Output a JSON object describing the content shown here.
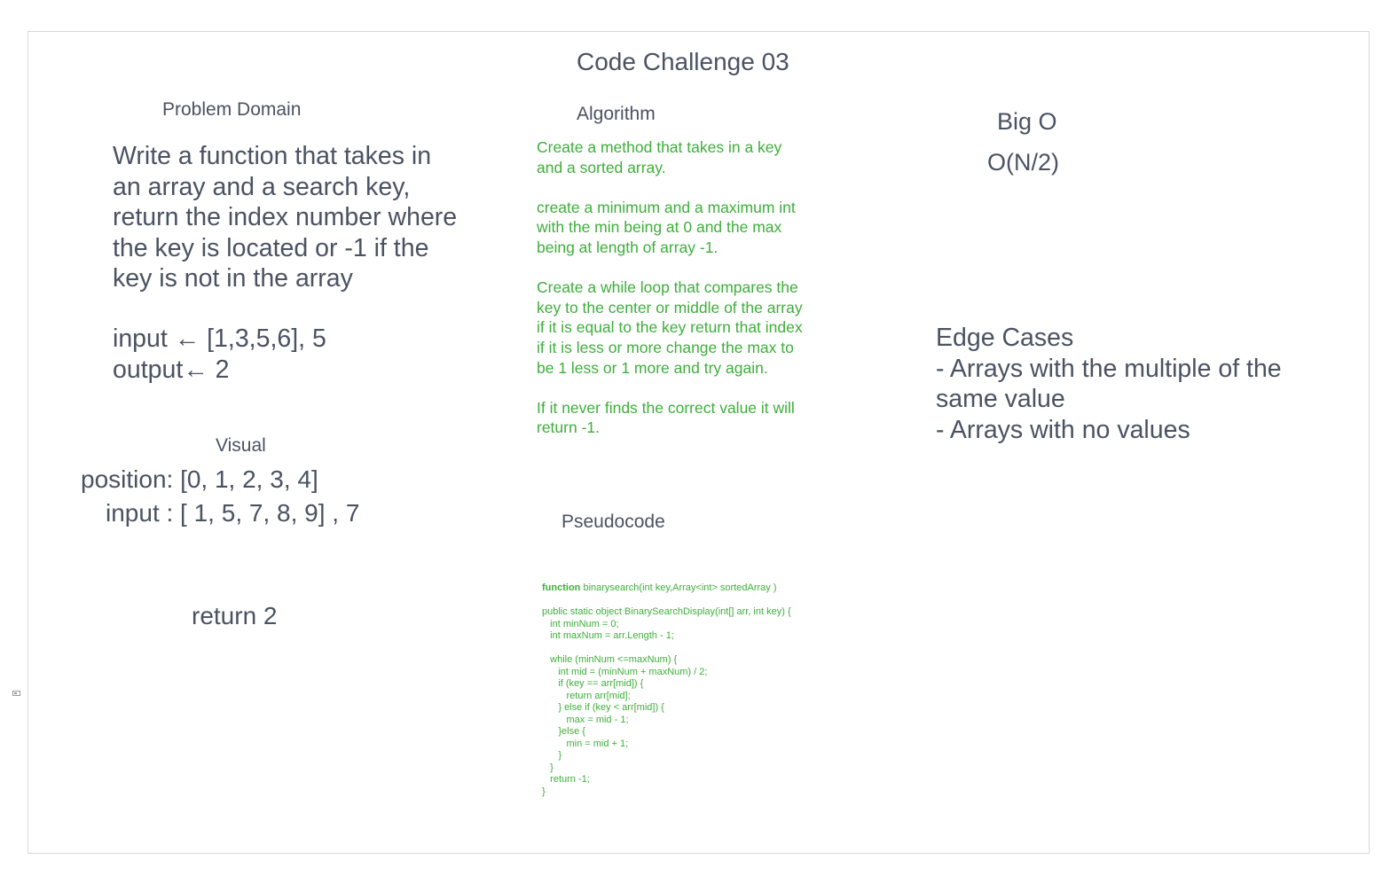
{
  "title": "Code Challenge 03",
  "problem_domain": {
    "heading": "Problem Domain",
    "text": "Write a function that takes in an array and a search key, return the index number where the key is located or -1 if the key is not in the array",
    "io": "input ← [1,3,5,6], 5\noutput← 2"
  },
  "visual": {
    "heading": "Visual",
    "position_line": "position: [0, 1, 2, 3, 4]",
    "input_line": "input : [ 1, 5, 7, 8, 9] , 7",
    "return_line": "return 2"
  },
  "algorithm": {
    "heading": "Algorithm",
    "steps": [
      "Create a method that takes in a key and a sorted array.",
      "create a minimum and a maximum int with the min being at 0 and the max being at length of array -1.",
      "Create a while loop that compares the key to the center or middle of the array if it is equal to the key return that index if it is less or more change the max to be 1 less or 1 more and try again.",
      "If it never finds the correct value it will return -1."
    ]
  },
  "pseudocode": {
    "heading": "Pseudocode",
    "signature_keyword": "function",
    "signature_rest": " binarysearch(int key,Array<int> sortedArray )",
    "code": "public static object BinarySearchDisplay(int[] arr, int key) {\n   int minNum = 0;\n   int maxNum = arr.Length - 1;\n\n   while (minNum <=maxNum) {\n      int mid = (minNum + maxNum) / 2;\n      if (key == arr[mid]) {\n         return arr[mid];\n      } else if (key < arr[mid]) {\n         max = mid - 1;\n      }else {\n         min = mid + 1;\n      }\n   }\n   return -1;\n}"
  },
  "big_o": {
    "heading": "Big O",
    "value": "O(N/2)"
  },
  "edge_cases": {
    "heading": "Edge Cases",
    "items": [
      "- Arrays with the multiple of the same value",
      "- Arrays with no values"
    ]
  },
  "colors": {
    "text_dark": "#4b5262",
    "text_green": "#3fae3c",
    "frame_border": "#d8d8d8"
  }
}
